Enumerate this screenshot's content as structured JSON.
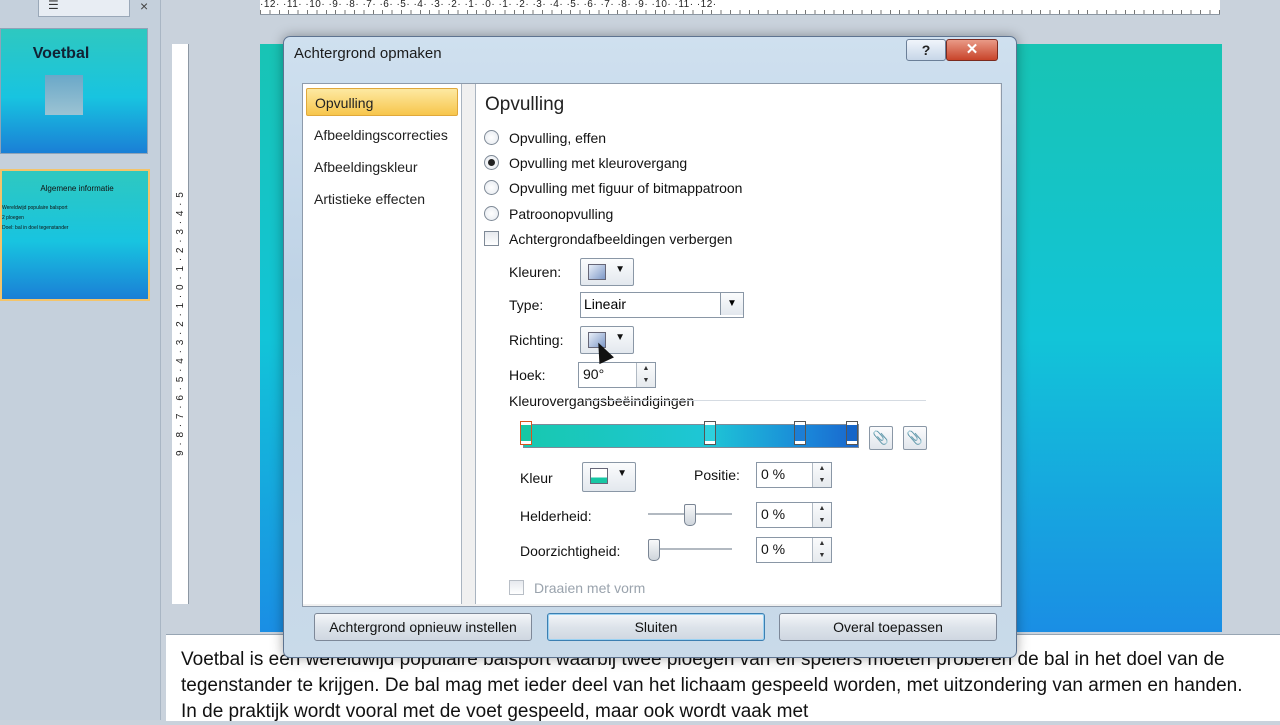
{
  "left_panel": {
    "tabs_glyph": "☰",
    "close_label": "×",
    "slides": [
      {
        "title": "Voetbal"
      },
      {
        "title": "Algemene informatie",
        "lines": [
          "Wereldwijd populaire balsport",
          "2 ploegen",
          "Doel: bal in doel tegenstander"
        ]
      }
    ]
  },
  "ruler": {
    "h_numbers": "·12·  ·11·  ·10·  ·9·  ·8·  ·7·  ·6·  ·5·  ·4·  ·3·  ·2·  ·1·  ·0·  ·1·  ·2·  ·3·  ·4·  ·5·  ·6·  ·7·  ·8·  ·9·  ·10·  ·11·  ·12·",
    "v_numbers": "9 · 8 · 7 · 6 · 5 · 4 · 3 · 2 · 1 · 0 · 1 · 2 · 3 · 4 · 5"
  },
  "notes": {
    "text": "Voetbal is een wereldwijd populaire balsport waarbij twee ploegen van elf spelers moeten proberen de bal in het doel van de tegenstander te krijgen. De bal mag met ieder deel van het lichaam gespeeld worden, met uitzondering van armen en handen. In de praktijk wordt vooral met de voet gespeeld, maar ook wordt vaak met"
  },
  "dialog": {
    "title": "Achtergrond opmaken",
    "help_label": "?",
    "close_label": "✕",
    "nav": [
      {
        "label": "Opvulling",
        "selected": true
      },
      {
        "label": "Afbeeldingscorrecties",
        "selected": false
      },
      {
        "label": "Afbeeldingskleur",
        "selected": false
      },
      {
        "label": "Artistieke effecten",
        "selected": false
      }
    ],
    "heading": "Opvulling",
    "fill_options": [
      {
        "label": "Opvulling, effen",
        "checked": false
      },
      {
        "label": "Opvulling met kleurovergang",
        "checked": true
      },
      {
        "label": "Opvulling met figuur of bitmappatroon",
        "checked": false
      },
      {
        "label": "Patroonopvulling",
        "checked": false
      }
    ],
    "hide_background_label": "Achtergrondafbeeldingen verbergen",
    "colors_label": "Kleuren:",
    "type_label": "Type:",
    "type_value": "Lineair",
    "direction_label": "Richting:",
    "angle_label": "Hoek:",
    "angle_value": "90°",
    "gradient_stops_label": "Kleurovergangsbeëindigingen",
    "stop_colors": [
      "#17c7a4",
      "#2ed0dd",
      "#1d7ed5",
      "#1565c8"
    ],
    "color_label": "Kleur",
    "position_label": "Positie:",
    "position_value": "0 %",
    "brightness_label": "Helderheid:",
    "brightness_value": "0 %",
    "transparency_label": "Doorzichtigheid:",
    "transparency_value": "0 %",
    "rotate_with_shape_label": "Draaien met vorm",
    "buttons": {
      "reset": "Achtergrond opnieuw instellen",
      "close": "Sluiten",
      "apply_all": "Overal toepassen"
    },
    "spinner_arrows": "▲\n▼",
    "dropdown_arrow": "▼",
    "add_stop_icon": "📎",
    "remove_stop_icon": "📎"
  }
}
